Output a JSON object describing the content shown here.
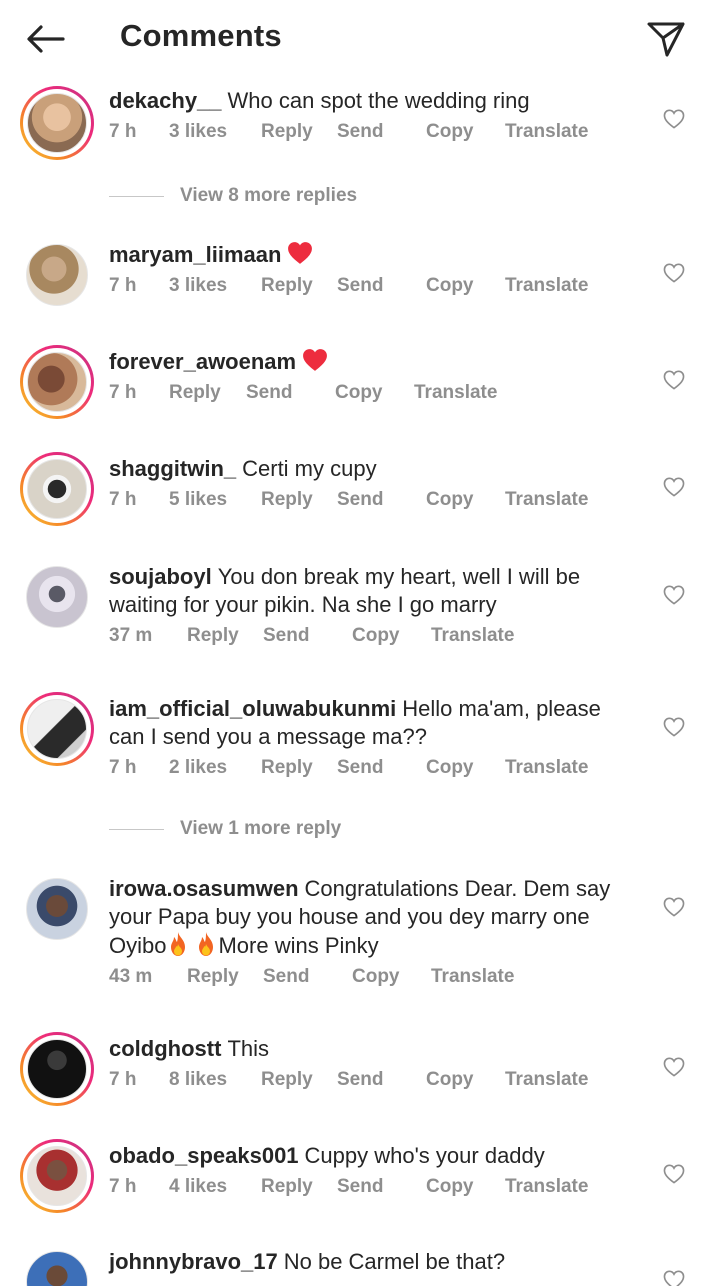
{
  "header": {
    "title": "Comments"
  },
  "comments": [
    {
      "username": "dekachy__",
      "text": "Who can spot the wedding ring",
      "time": "7 h",
      "likes": "3 likes",
      "reply": "Reply",
      "send": "Send",
      "copy": "Copy",
      "translate": "Translate",
      "avatar_color": "#c9a07a",
      "story": true
    },
    {
      "username": "maryam_liimaan",
      "text": "",
      "time": "7 h",
      "likes": "3 likes",
      "reply": "Reply",
      "send": "Send",
      "copy": "Copy",
      "translate": "Translate",
      "avatar_color": "#b99670",
      "story": false
    },
    {
      "username": "forever_awoenam",
      "text": "",
      "time": "7 h",
      "reply": "Reply",
      "send": "Send",
      "copy": "Copy",
      "translate": "Translate",
      "avatar_color": "#9f6e58",
      "story": true
    },
    {
      "username": "shaggitwin_",
      "text": "Certi my cupy",
      "time": "7 h",
      "likes": "5 likes",
      "reply": "Reply",
      "send": "Send",
      "copy": "Copy",
      "translate": "Translate",
      "avatar_color": "#d9d3c8",
      "story": true
    },
    {
      "username": "soujaboyl",
      "text": "You don break my heart,  well I will be waiting for your pikin. Na she I go marry",
      "time": "37 m",
      "reply": "Reply",
      "send": "Send",
      "copy": "Copy",
      "translate": "Translate",
      "avatar_color": "#c9c4d0",
      "story": false
    },
    {
      "username": "iam_official_oluwabukunmi",
      "text": "Hello ma'am, please can I send you a message ma??",
      "time": "7 h",
      "likes": "2 likes",
      "reply": "Reply",
      "send": "Send",
      "copy": "Copy",
      "translate": "Translate",
      "avatar_color": "#3a3a3a",
      "story": true
    },
    {
      "username": "irowa.osasumwen",
      "text": "Congratulations Dear. Dem say your Papa buy you house and you dey marry one Oyibo",
      "text_after": "More wins Pinky",
      "time": "43 m",
      "reply": "Reply",
      "send": "Send",
      "copy": "Copy",
      "translate": "Translate",
      "avatar_color": "#8a95a8",
      "story": false
    },
    {
      "username": "coldghostt",
      "text": "This",
      "time": "7 h",
      "likes": "8 likes",
      "reply": "Reply",
      "send": "Send",
      "copy": "Copy",
      "translate": "Translate",
      "avatar_color": "#111111",
      "story": true
    },
    {
      "username": "obado_speaks001",
      "text": "Cuppy who's your daddy",
      "time": "7 h",
      "likes": "4 likes",
      "reply": "Reply",
      "send": "Send",
      "copy": "Copy",
      "translate": "Translate",
      "avatar_color": "#9a6a55",
      "story": true
    },
    {
      "username": "johnnybravo_17",
      "text": "No be Carmel be that?",
      "avatar_color": "#3d6fb8",
      "story": false
    }
  ],
  "view_more": [
    {
      "label": "View 8 more replies"
    },
    {
      "label": "View 1 more reply"
    }
  ],
  "colors": {
    "text": "#262626",
    "meta": "#8e8e8e",
    "heart": "#ed2c3e",
    "fire": "#f26522"
  },
  "icons": {
    "back": "back-arrow-icon",
    "share": "send-icon",
    "like": "heart-outline-icon"
  }
}
